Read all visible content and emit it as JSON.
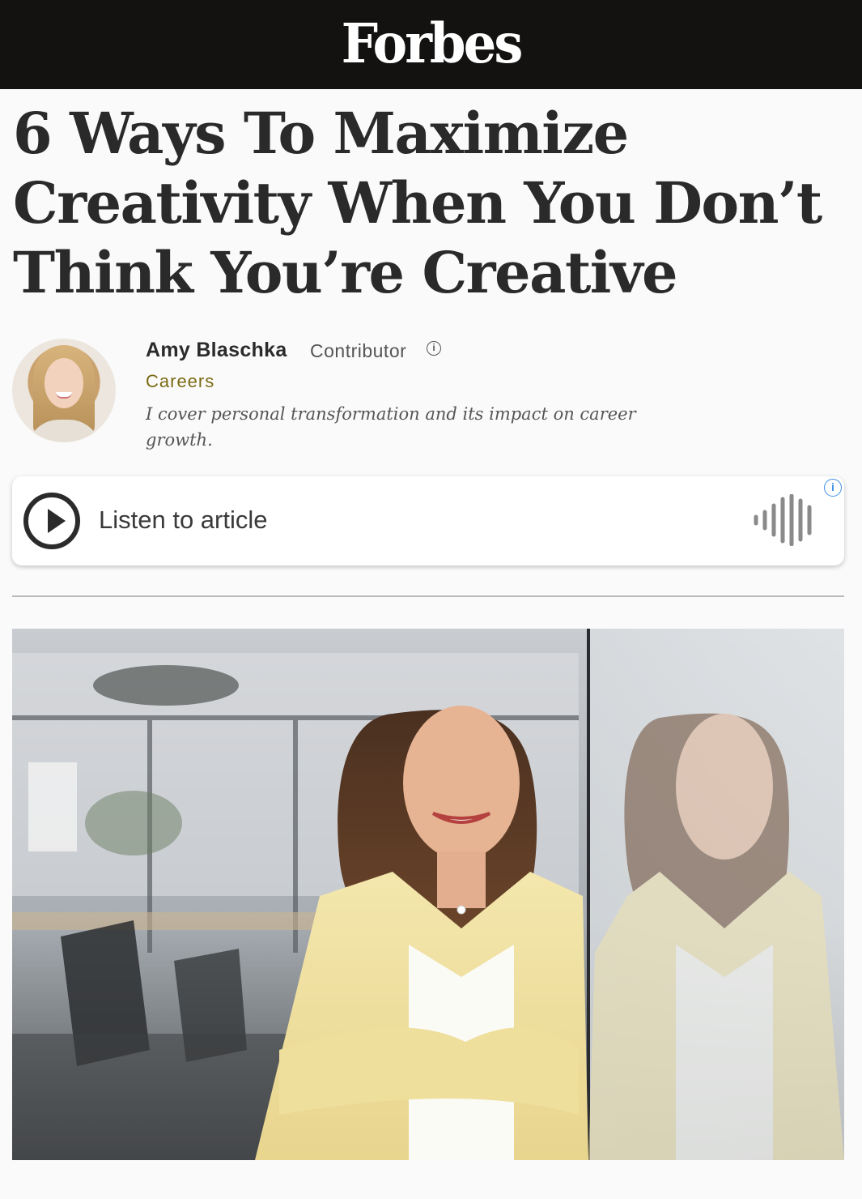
{
  "header": {
    "logo": "Forbes"
  },
  "article": {
    "headline": "6 Ways To Maximize Creativity When You Don’t Think You’re Creative"
  },
  "author": {
    "name": "Amy Blaschka",
    "role": "Contributor",
    "section": "Careers",
    "bio": "I cover personal transformation and its impact on career growth."
  },
  "audio": {
    "label": "Listen to article"
  },
  "colors": {
    "topbar": "#141210",
    "section_link": "#7b6a12",
    "ad_info": "#3d8fe6"
  },
  "icons": {
    "info": "info-circle-icon",
    "play": "play-circle-icon",
    "waveform": "audio-waveform-icon",
    "ad_info": "ad-info-icon"
  }
}
